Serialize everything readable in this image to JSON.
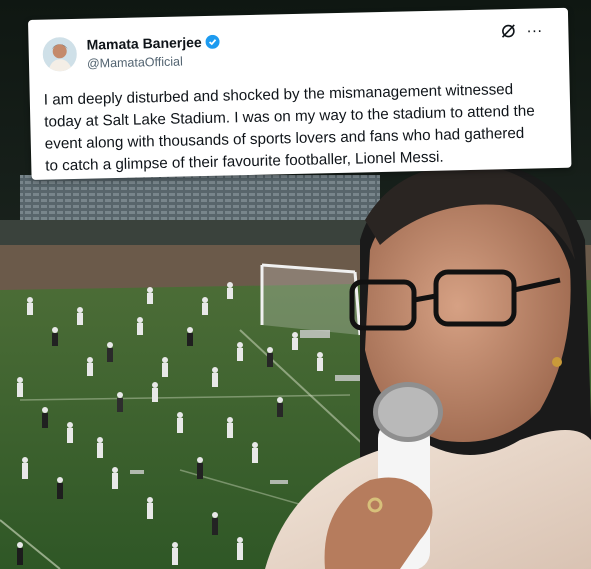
{
  "tweet": {
    "author_name": "Mamata Banerjee",
    "handle": "@MamataOfficial",
    "lines": [
      "I am deeply disturbed and shocked by the mismanagement witnessed",
      "today at Salt Lake Stadium. I was on my way to the stadium to attend the",
      "event along with thousands of sports lovers and fans who had gathered",
      "to catch a glimpse of their favourite footballer, Lionel Messi."
    ],
    "icons": {
      "verified": "verified-badge-icon",
      "grok": "grok-icon",
      "more": "more-options-icon"
    },
    "more_glyph": "···",
    "verified_color": "#1d9bf0"
  }
}
